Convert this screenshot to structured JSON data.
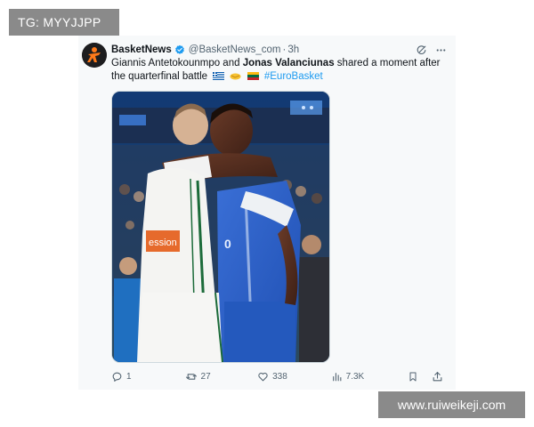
{
  "overlay": {
    "tg_label": "TG: MYYJJPP",
    "watermark_url": "www.ruiweikeji.com"
  },
  "tweet": {
    "display_name": "BasketNews",
    "handle": "@BasketNews_com",
    "separator": "·",
    "time": "3h",
    "text_part1": "Giannis Antetokounmpo and ",
    "bold_name": "Jonas Valanciunas",
    "text_part2": " shared a moment after the quarterfinal battle",
    "hashtag": "#EuroBasket",
    "image_text": {
      "jersey_sponsor": "ession",
      "jersey_number": "0"
    },
    "stats": {
      "replies": "1",
      "retweets": "27",
      "likes": "338",
      "views": "7.3K"
    }
  },
  "colors": {
    "accent": "#1d9bf0",
    "verified": "#1d9bf0",
    "text_primary": "#0f1419",
    "text_secondary": "#536471",
    "watermark_bg": "#8a8a8a"
  },
  "icons": {
    "avatar": "basketnews-logo-icon",
    "verified": "verified-badge-icon",
    "grok": "grok-icon",
    "more": "more-icon",
    "flags": [
      "greece-flag-icon",
      "handshake-icon",
      "lithuania-flag-icon"
    ],
    "actions": [
      "reply-icon",
      "retweet-icon",
      "like-icon",
      "views-icon",
      "bookmark-icon",
      "share-icon"
    ]
  }
}
